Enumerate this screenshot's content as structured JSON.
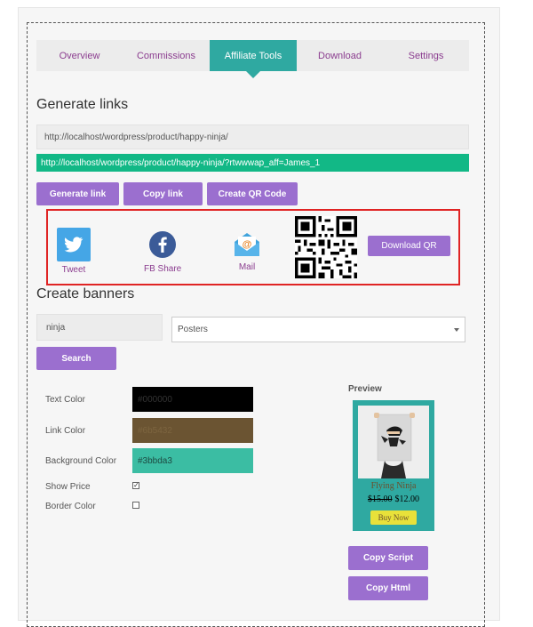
{
  "tabs": [
    {
      "label": "Overview",
      "active": false
    },
    {
      "label": "Commissions",
      "active": false
    },
    {
      "label": "Affiliate Tools",
      "active": true
    },
    {
      "label": "Download",
      "active": false
    },
    {
      "label": "Settings",
      "active": false
    }
  ],
  "generate_links": {
    "title": "Generate links",
    "product_url": "http://localhost/wordpress/product/happy-ninja/",
    "affiliate_url": "http://localhost/wordpress/product/happy-ninja/?rtwwwap_aff=James_1",
    "generate_btn": "Generate link",
    "copy_btn": "Copy link",
    "qr_btn": "Create QR Code"
  },
  "share": {
    "tweet": "Tweet",
    "fb": "FB Share",
    "mail": "Mail",
    "download_qr": "Download QR"
  },
  "banners": {
    "title": "Create banners",
    "search_value": "ninja",
    "select_value": "Posters",
    "search_btn": "Search",
    "text_color_label": "Text Color",
    "text_color_value": "#000000",
    "link_color_label": "Link Color",
    "link_color_value": "#6b5432",
    "bg_color_label": "Background Color",
    "bg_color_value": "#3bbda3",
    "show_price_label": "Show Price",
    "show_price_checked": true,
    "border_color_label": "Border Color",
    "border_color_checked": false
  },
  "preview": {
    "label": "Preview",
    "product_name": "Flying Ninja",
    "old_price": "$15.00",
    "new_price": "$12.00",
    "buy_label": "Buy Now",
    "copy_script_btn": "Copy Script",
    "copy_html_btn": "Copy Html"
  },
  "colors": {
    "accent_purple": "#9b6fcf",
    "teal": "#2fa9a1",
    "green": "#12b886",
    "highlight_red": "#e02424"
  }
}
